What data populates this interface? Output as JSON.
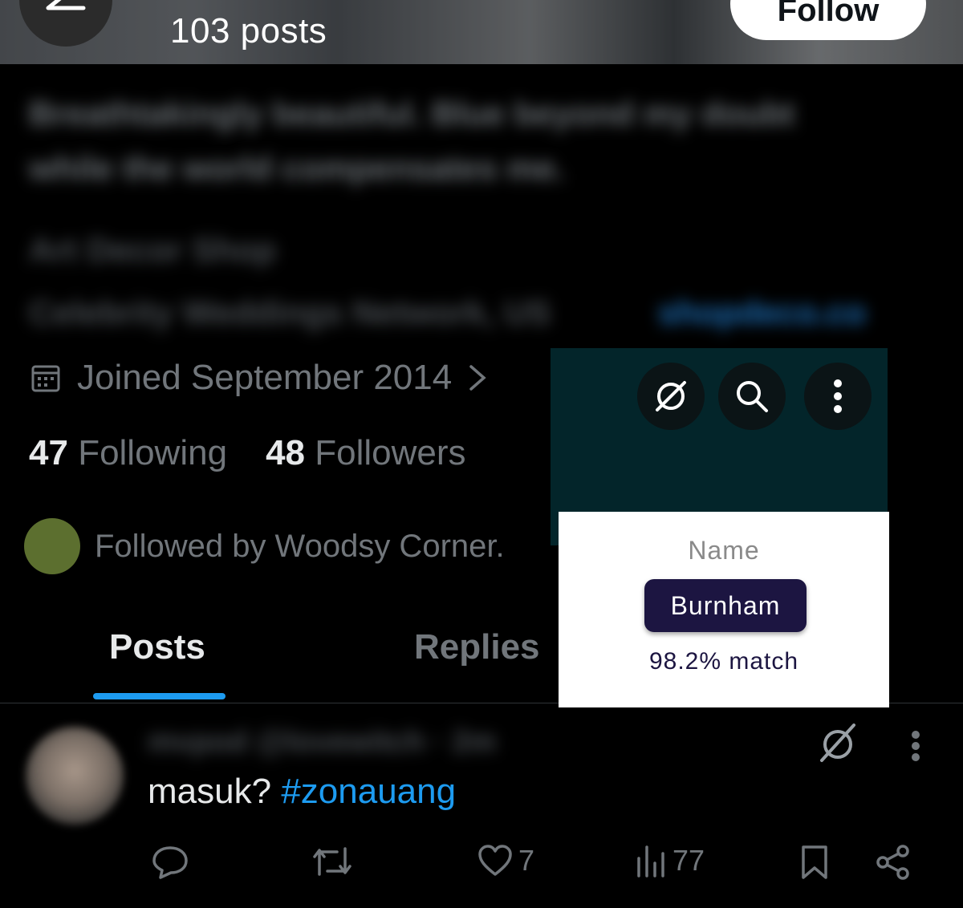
{
  "header": {
    "posts_count": "103 posts",
    "follow_label": "Follow"
  },
  "bio": {
    "line1": "Breathtakingly beautiful. Blue beyond my doubt",
    "line2": "while the world compensates me.",
    "category": "Art Decor Shop",
    "location": "Celebrity Weddings Network, US",
    "link": "shopdeco.co"
  },
  "profile": {
    "joined": "Joined September 2014",
    "following_count": "47",
    "following_label": "Following",
    "followers_count": "48",
    "followers_label": "Followers",
    "followed_by": "Followed by Woodsy Corner."
  },
  "tabs": [
    {
      "label": "Posts",
      "active": true
    },
    {
      "label": "Replies",
      "active": false
    }
  ],
  "overlay": {
    "name_label": "Name",
    "name_value": "Burnham",
    "match_text": "98.2% match"
  },
  "tweet": {
    "meta": "mvpod @lovewitch · 2m",
    "text": "masuk?",
    "hashtag": "#zonauang",
    "likes": "7",
    "views": "77"
  },
  "colors": {
    "accent": "#1d9bf0",
    "overlay_bg": "#03252a",
    "chip_bg": "#1c1541",
    "muted_text": "#71767b"
  }
}
